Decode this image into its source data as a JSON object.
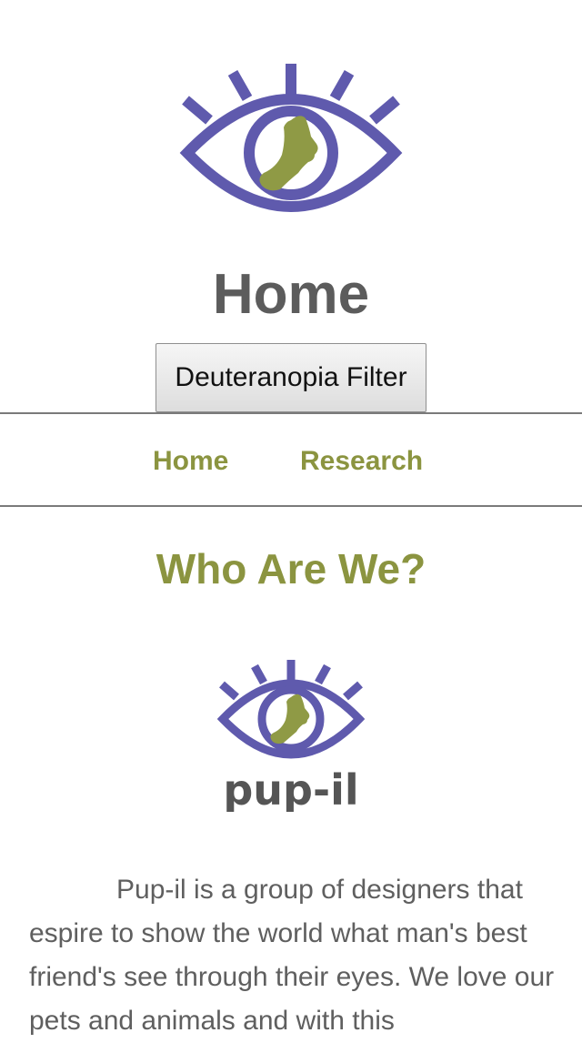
{
  "header": {
    "logo_icon": "pupil-eye-icon",
    "title": "Home",
    "filter_button_label": "Deuteranopia Filter"
  },
  "nav": {
    "items": [
      {
        "label": "Home"
      },
      {
        "label": "Research"
      }
    ]
  },
  "main": {
    "heading": "Who Are We?",
    "brand_logo_icon": "pupil-eye-logo-icon",
    "brand_name": "pup-il",
    "intro": "Pup-il is a group of designers that espire to show the world what man's best friend's see through their eyes. We love our pets and animals and with this"
  },
  "colors": {
    "eye_purple": "#5f5aad",
    "dog_olive": "#8f9a45",
    "accent_olive_text": "#8b9440",
    "heading_gray": "#5c5c5c",
    "body_gray": "#5f5f5f",
    "divider_gray": "#7a7a7a"
  }
}
